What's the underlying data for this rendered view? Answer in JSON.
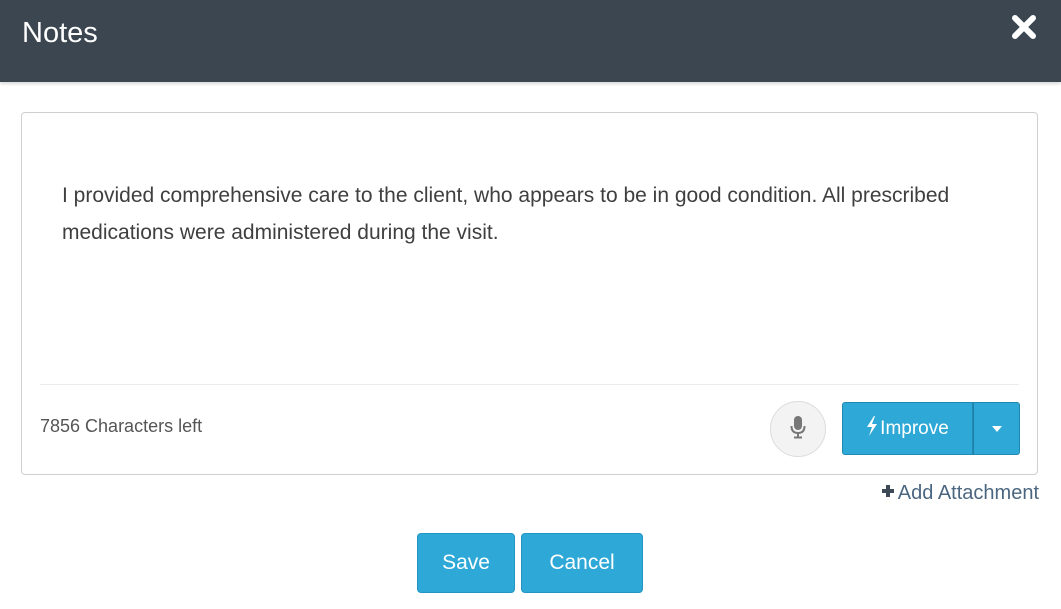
{
  "header": {
    "title": "Notes",
    "close_icon": "close-icon"
  },
  "note": {
    "text": "I provided comprehensive care to the client, who appears to be in good condition. All prescribed medications were administered during the visit.",
    "characters_left": "7856 Characters left"
  },
  "toolbar": {
    "mic_icon": "microphone-icon",
    "improve_label": "Improve",
    "improve_icon": "bolt-icon",
    "dropdown_icon": "caret-down-icon"
  },
  "attachment": {
    "label": "Add Attachment",
    "icon": "plus-icon"
  },
  "footer": {
    "save_label": "Save",
    "cancel_label": "Cancel"
  },
  "colors": {
    "header_bg": "#3b4650",
    "primary": "#2ea8d6",
    "link": "#4a6680"
  }
}
